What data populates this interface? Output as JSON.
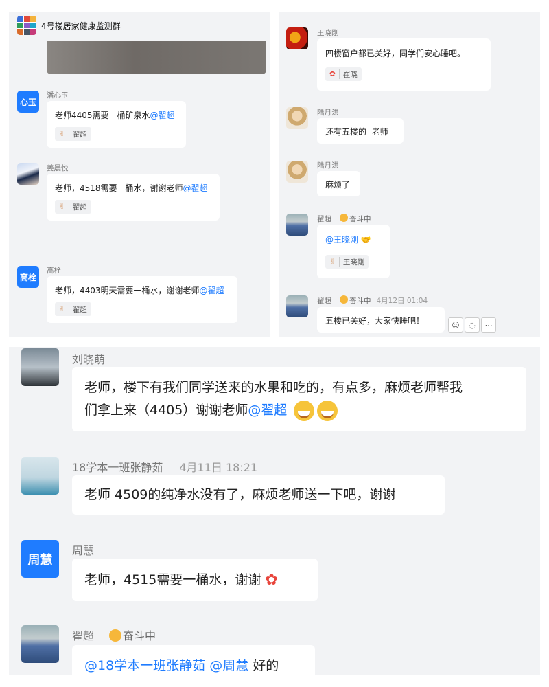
{
  "panel_top_left": {
    "group_title": "4号楼居家健康监测群",
    "messages": [
      {
        "sender": "潘心玉",
        "avatar_text": "心玉",
        "text": "老师4405需要一桶矿泉水",
        "mention": "@翟超",
        "reaction_user": "翟超"
      },
      {
        "sender": "姜晨悦",
        "text": "老师，4518需要一桶水，谢谢老师",
        "mention": "@翟超",
        "reaction_user": "翟超"
      },
      {
        "sender": "高栓",
        "avatar_text": "高栓",
        "text": "老师，4403明天需要一桶水，谢谢老师",
        "mention": "@翟超",
        "reaction_user": "翟超"
      }
    ]
  },
  "panel_top_right": {
    "messages": [
      {
        "sender": "王晓刚",
        "text": "四楼窗户都已关好，同学们安心睡吧。",
        "reaction_user": "崔晓"
      },
      {
        "sender": "陆月洪",
        "text": "还有五楼的  老师"
      },
      {
        "sender": "陆月洪",
        "text": "麻烦了"
      },
      {
        "sender": "翟超",
        "status": "奋斗中",
        "mention": "@王晓刚",
        "reaction_user": "王晓刚"
      },
      {
        "sender": "翟超",
        "status": "奋斗中",
        "time": "4月12日 01:04",
        "text": "五楼已关好，大家快睡吧！"
      }
    ]
  },
  "panel_bottom": {
    "messages": [
      {
        "sender": "刘晓萌",
        "text_line1": "老师，楼下有我们同学送来的水果和吃的，有点多，麻烦老师帮我",
        "text_line2": "们拿上来（4405）谢谢老师",
        "mention": "@翟超"
      },
      {
        "sender": "18学本一班张静茹",
        "time": "4月11日 18:21",
        "text": "老师 4509的纯净水没有了，麻烦老师送一下吧，谢谢"
      },
      {
        "sender": "周慧",
        "avatar_text": "周慧",
        "text": "老师，4515需要一桶水，谢谢"
      },
      {
        "sender": "翟超",
        "status": "奋斗中",
        "mention1": "@18学本一班张静茹",
        "mention2": "@周慧",
        "text": "好的"
      }
    ]
  },
  "colors": {
    "accent": "#1f7cff",
    "panel_bg": "#f2f3f5",
    "bubble_bg": "#ffffff"
  },
  "icons": [
    "emoji-reaction-icon",
    "reply-icon",
    "more-icon"
  ]
}
